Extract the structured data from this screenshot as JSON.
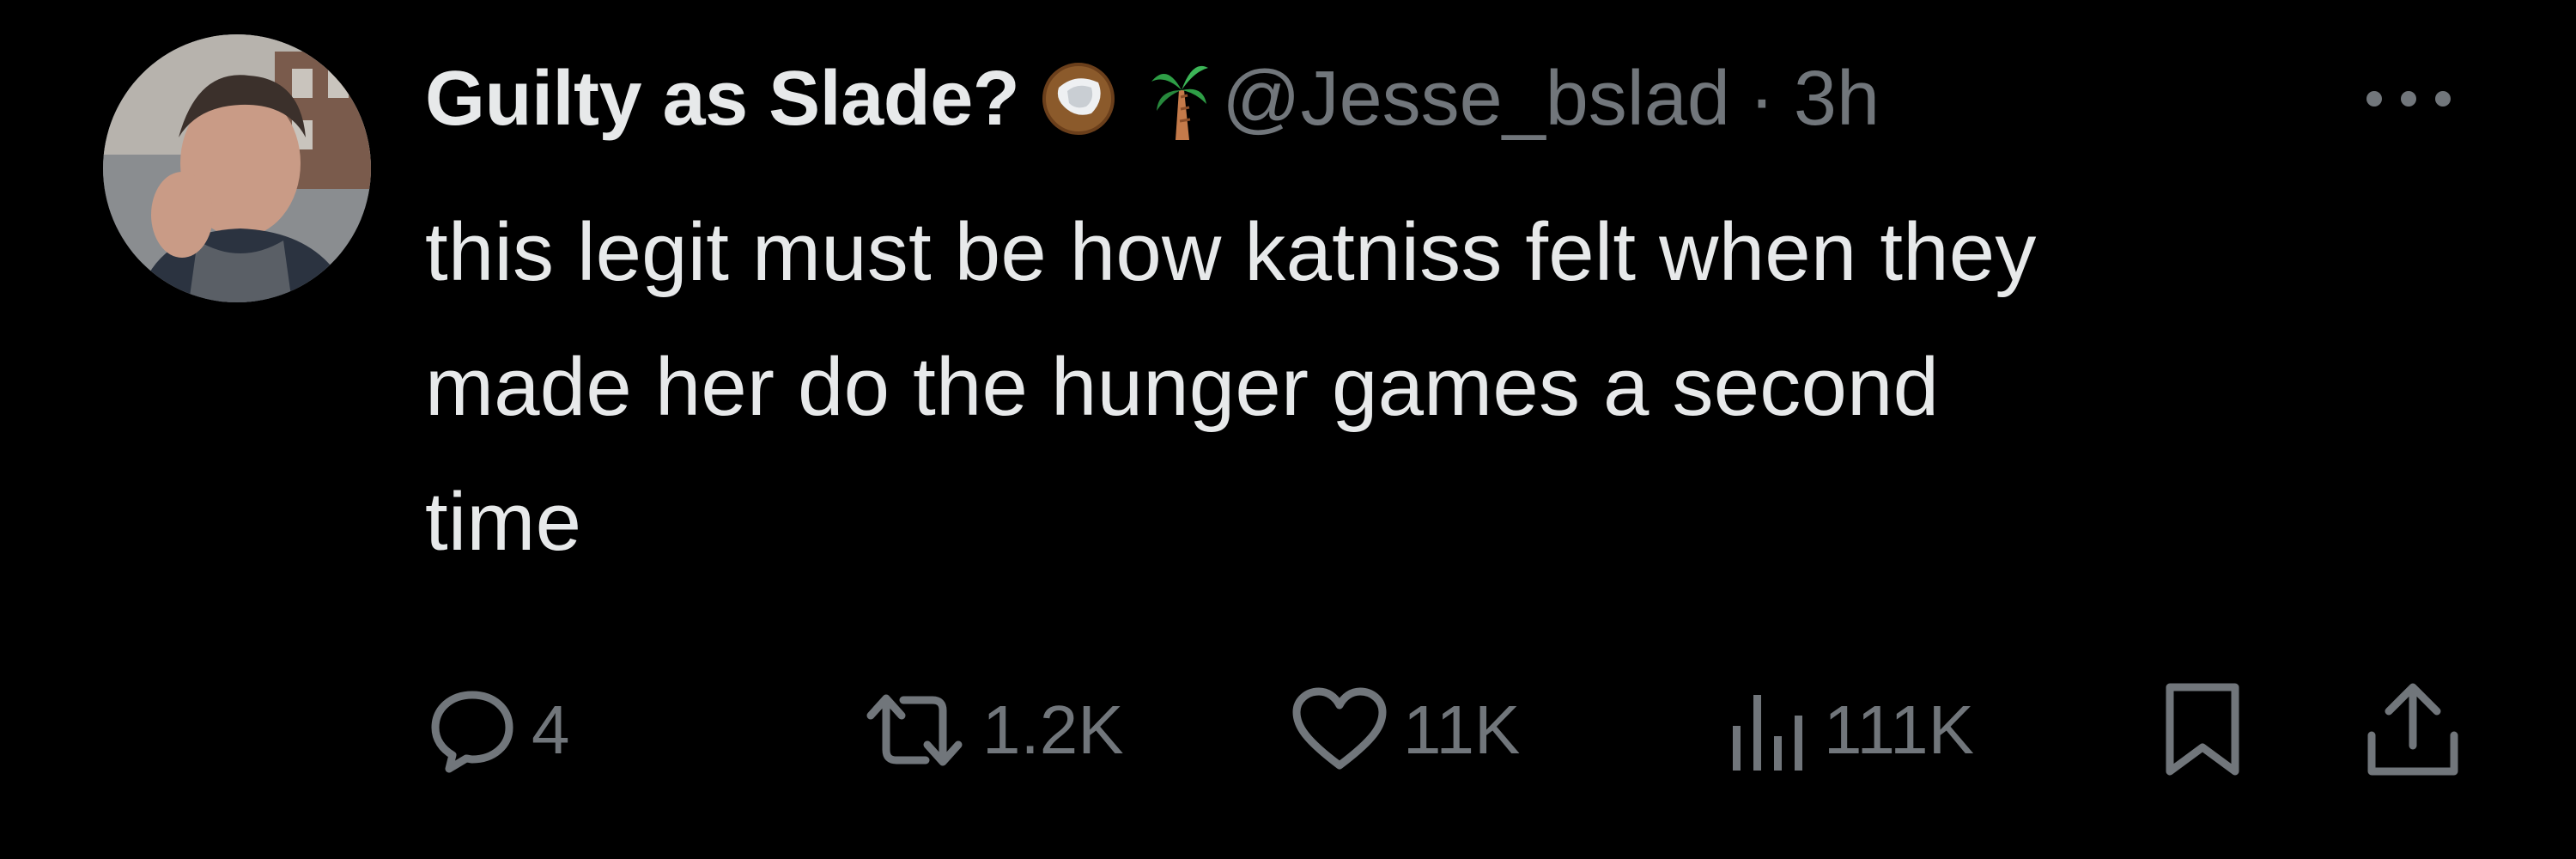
{
  "author": {
    "display_name": "Guilty as Slade?",
    "emojis": [
      "coconut-emoji",
      "palm-tree-emoji"
    ],
    "handle": "@Jesse_bslad",
    "separator": "·",
    "time": "3h"
  },
  "tweet": {
    "lines": [
      "this legit must be how katniss felt when they",
      "made her do the hunger games a second",
      "time"
    ]
  },
  "actions": {
    "reply_count": "4",
    "retweet_count": "1.2K",
    "like_count": "11K",
    "view_count": "111K"
  },
  "icons": {
    "more": "more-options-icon",
    "reply": "reply-icon",
    "retweet": "retweet-icon",
    "like": "heart-icon",
    "views": "views-chart-icon",
    "bookmark": "bookmark-icon",
    "share": "share-icon"
  },
  "colors": {
    "background": "#000000",
    "primary_text": "#e7e9ea",
    "secondary_text": "#71767b"
  }
}
